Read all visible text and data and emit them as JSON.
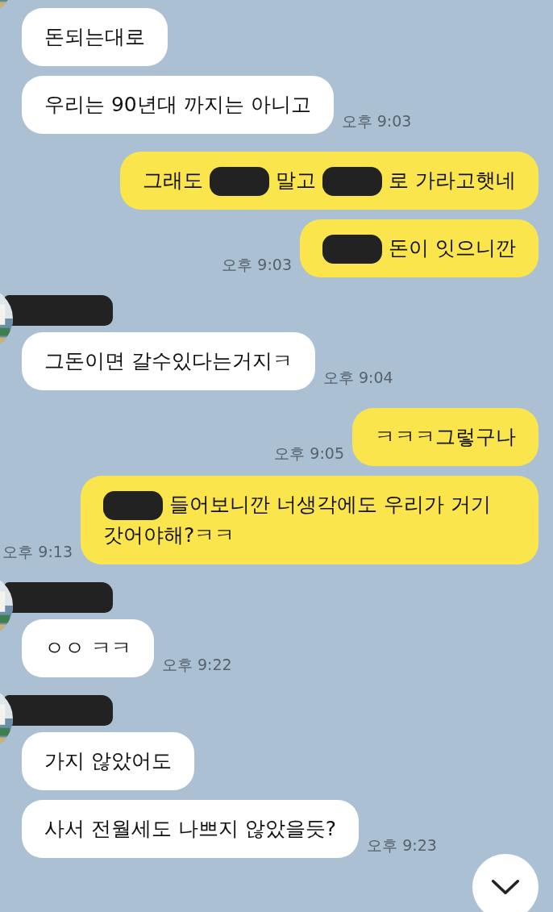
{
  "groups": [
    {
      "kind": "received",
      "show_avatar": true,
      "show_name": false,
      "messages": [
        {
          "segments": [
            {
              "kind": "text",
              "text": "돈되는대로"
            }
          ]
        },
        {
          "segments": [
            {
              "kind": "text",
              "text": "우리는 90년대 까지는 아니고"
            }
          ],
          "time": "오후 9:03"
        }
      ]
    },
    {
      "kind": "sent",
      "show_avatar": false,
      "show_name": false,
      "messages": [
        {
          "segments": [
            {
              "kind": "text",
              "text": "그래도"
            },
            {
              "kind": "redacted"
            },
            {
              "kind": "text",
              "text": "말고"
            },
            {
              "kind": "redacted"
            },
            {
              "kind": "text",
              "text": "로 가라고햇네"
            }
          ]
        },
        {
          "segments": [
            {
              "kind": "redacted"
            },
            {
              "kind": "text",
              "text": "돈이 잇으니깐"
            }
          ],
          "time": "오후 9:03"
        }
      ]
    },
    {
      "kind": "received",
      "show_avatar": true,
      "show_name": true,
      "messages": [
        {
          "segments": [
            {
              "kind": "text",
              "text": "그돈이면 갈수있다는거지ㅋ"
            }
          ],
          "time": "오후 9:04"
        }
      ]
    },
    {
      "kind": "sent",
      "show_avatar": false,
      "show_name": false,
      "messages": [
        {
          "segments": [
            {
              "kind": "text",
              "text": "ㅋㅋㅋ그렇구나"
            }
          ],
          "time": "오후 9:05"
        },
        {
          "segments": [
            {
              "kind": "redacted"
            },
            {
              "kind": "text",
              "text": "들어보니깐 너생각에도 우리가 거기"
            },
            {
              "kind": "text",
              "text": "갓어야해?ㅋㅋ"
            }
          ],
          "time": "오후 9:13"
        }
      ]
    },
    {
      "kind": "received",
      "show_avatar": true,
      "show_name": true,
      "messages": [
        {
          "segments": [
            {
              "kind": "text",
              "text": "ㅇㅇ ㅋㅋ"
            }
          ],
          "time": "오후 9:22"
        }
      ]
    },
    {
      "kind": "received",
      "show_avatar": true,
      "show_name": true,
      "messages": [
        {
          "segments": [
            {
              "kind": "text",
              "text": "가지 않았어도"
            }
          ]
        },
        {
          "segments": [
            {
              "kind": "text",
              "text": "사서 전월세도 나쁘지 않았을듯?"
            }
          ],
          "time": "오후 9:23"
        }
      ]
    }
  ]
}
